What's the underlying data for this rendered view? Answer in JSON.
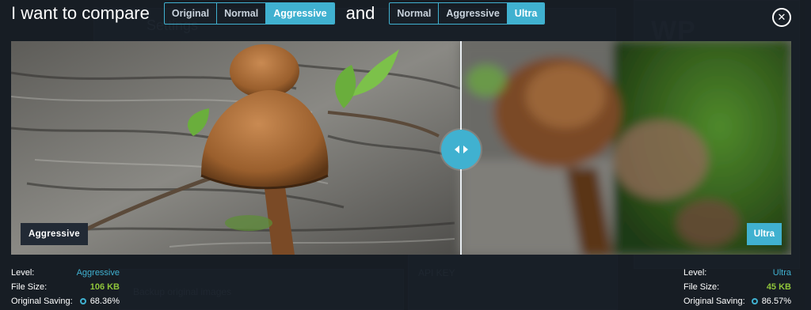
{
  "header": {
    "title": "I want to compare",
    "and_text": "and",
    "left_options": [
      {
        "label": "Original",
        "active": false
      },
      {
        "label": "Normal",
        "active": false
      },
      {
        "label": "Aggressive",
        "active": true
      }
    ],
    "right_options": [
      {
        "label": "Normal",
        "active": false
      },
      {
        "label": "Aggressive",
        "active": false
      },
      {
        "label": "Ultra",
        "active": true
      }
    ]
  },
  "close_icon": "close-icon",
  "viewer": {
    "left_tag": "Aggressive",
    "right_tag": "Ultra"
  },
  "left_stats": {
    "level_label": "Level:",
    "level_value": "Aggressive",
    "size_label": "File Size:",
    "size_value": "106 KB",
    "saving_label": "Original Saving:",
    "saving_value": "68.36%"
  },
  "right_stats": {
    "level_label": "Level:",
    "level_value": "Ultra",
    "size_label": "File Size:",
    "size_value": "45 KB",
    "saving_label": "Original Saving:",
    "saving_value": "86.57%"
  },
  "colors": {
    "accent": "#40b1d0",
    "size_green": "#8fc43a",
    "panel_dark": "#222a35"
  }
}
